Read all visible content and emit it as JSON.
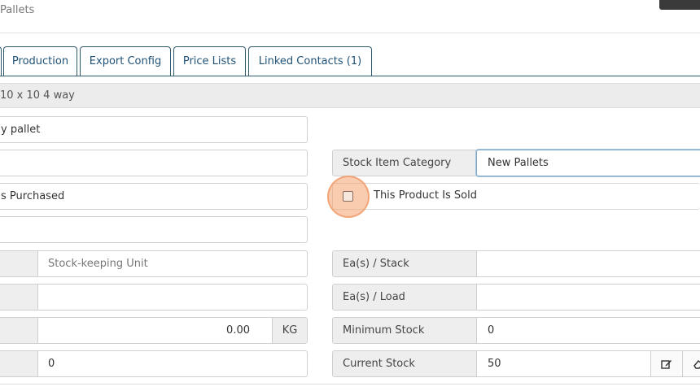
{
  "breadcrumb": "Pallets",
  "tabs": [
    {
      "label": "Production"
    },
    {
      "label": "Export Config"
    },
    {
      "label": "Price Lists"
    },
    {
      "label": "Linked Contacts (1)"
    }
  ],
  "section_title": "10 x 10 4 way",
  "left_fields": {
    "row1_value": "y pallet",
    "row2_value": "",
    "row3_value": "s Purchased",
    "row4_value": "",
    "sku_placeholder": "Stock-keeping Unit",
    "row6_value": "",
    "weight_value": "0.00",
    "weight_unit": "KG",
    "row8_value": "0"
  },
  "stock_item_category": {
    "label": "Stock Item Category",
    "value": "New Pallets"
  },
  "sold_checkbox": {
    "label": "This Product Is Sold",
    "checked": false
  },
  "ea_stack": {
    "label": "Ea(s) / Stack",
    "value": ""
  },
  "ea_load": {
    "label": "Ea(s) / Load",
    "value": ""
  },
  "minimum_stock": {
    "label": "Minimum Stock",
    "value": "0"
  },
  "current_stock": {
    "label": "Current Stock",
    "value": "50"
  },
  "icons": {
    "edit": "edit-icon",
    "eraser": "eraser-icon"
  }
}
